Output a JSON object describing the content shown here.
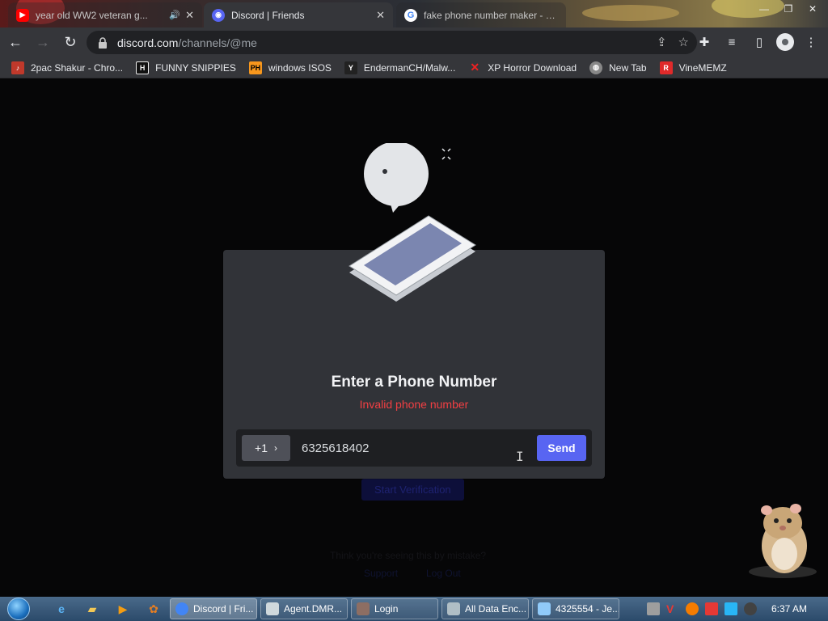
{
  "browser": {
    "tabs": [
      {
        "title": "year old WW2 veteran g...",
        "icon": "youtube-icon",
        "active": false
      },
      {
        "title": "Discord | Friends",
        "icon": "discord-icon",
        "active": true
      },
      {
        "title": "fake phone number maker - Go",
        "icon": "google-icon",
        "active": false
      }
    ],
    "url_host": "discord.com",
    "url_path": "/channels/@me",
    "bookmarks": [
      {
        "label": "2pac Shakur - Chro...",
        "icon": "music-icon",
        "color": "#c0392b"
      },
      {
        "label": "FUNNY SNIPPIES",
        "icon": "h-icon",
        "color": "#111111"
      },
      {
        "label": "windows ISOS",
        "icon": "ph-icon",
        "color": "#f7971d"
      },
      {
        "label": "EndermanCH/Malw...",
        "icon": "yp-icon",
        "color": "#222222"
      },
      {
        "label": "XP Horror Download",
        "icon": "x-icon",
        "color": "#d11"
      },
      {
        "label": "New Tab",
        "icon": "globe-icon",
        "color": "#888888"
      },
      {
        "label": "VineMEMZ",
        "icon": "r-icon",
        "color": "#e02a2a"
      }
    ]
  },
  "background_page": {
    "button": "Start Verification",
    "help_text": "Think you're seeing this by mistake?",
    "support": "Support",
    "logout": "Log Out"
  },
  "modal": {
    "title": "Enter a Phone Number",
    "error": "Invalid phone number",
    "country_code": "+1",
    "phone_value": "6325618402",
    "send_label": "Send"
  },
  "taskbar": {
    "tasks": [
      {
        "label": "Discord | Fri...",
        "active": true,
        "color": "#4285f4"
      },
      {
        "label": "Agent.DMR...",
        "active": false,
        "color": "#cfd8dc"
      },
      {
        "label": "Login",
        "active": false,
        "color": "#8d6e63"
      },
      {
        "label": "All Data Enc...",
        "active": false,
        "color": "#b0bec5"
      },
      {
        "label": "4325554 - Je...",
        "active": false,
        "color": "#90caf9"
      }
    ],
    "clock": "6:37 AM"
  },
  "colors": {
    "accent": "#5865f2",
    "error": "#f23f43",
    "modal_bg": "#313338"
  }
}
